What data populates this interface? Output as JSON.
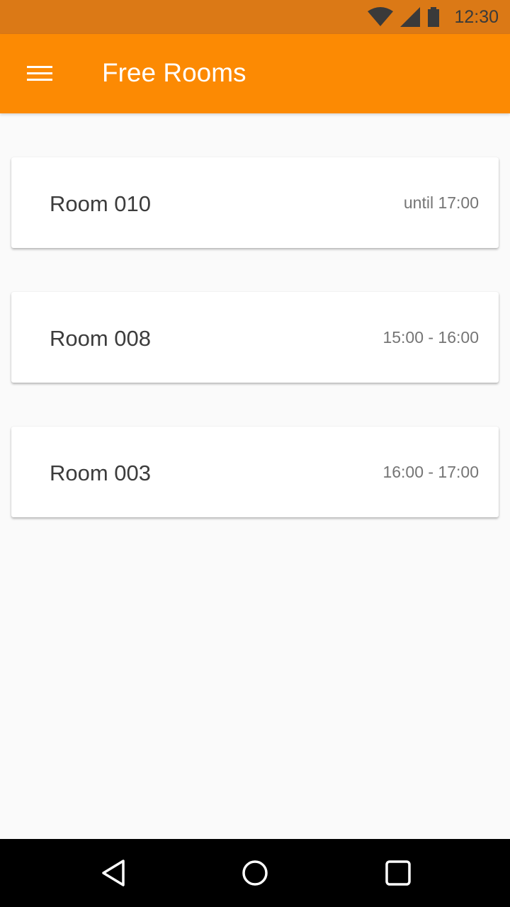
{
  "status_bar": {
    "time": "12:30",
    "icons": [
      "wifi-icon",
      "cell-signal-icon",
      "battery-icon"
    ]
  },
  "app_bar": {
    "title": "Free Rooms",
    "menu_icon": "hamburger-menu-icon"
  },
  "rooms": [
    {
      "name": "Room 010",
      "time": "until 17:00"
    },
    {
      "name": "Room 008",
      "time": "15:00 - 16:00"
    },
    {
      "name": "Room 003",
      "time": "16:00 - 17:00"
    }
  ],
  "nav_bar": {
    "buttons": [
      "back-icon",
      "home-icon",
      "recent-apps-icon"
    ]
  },
  "colors": {
    "status_bar": "#db7916",
    "app_bar": "#fc8a03",
    "background": "#fafafa",
    "card": "#ffffff",
    "nav_bar": "#000000"
  }
}
